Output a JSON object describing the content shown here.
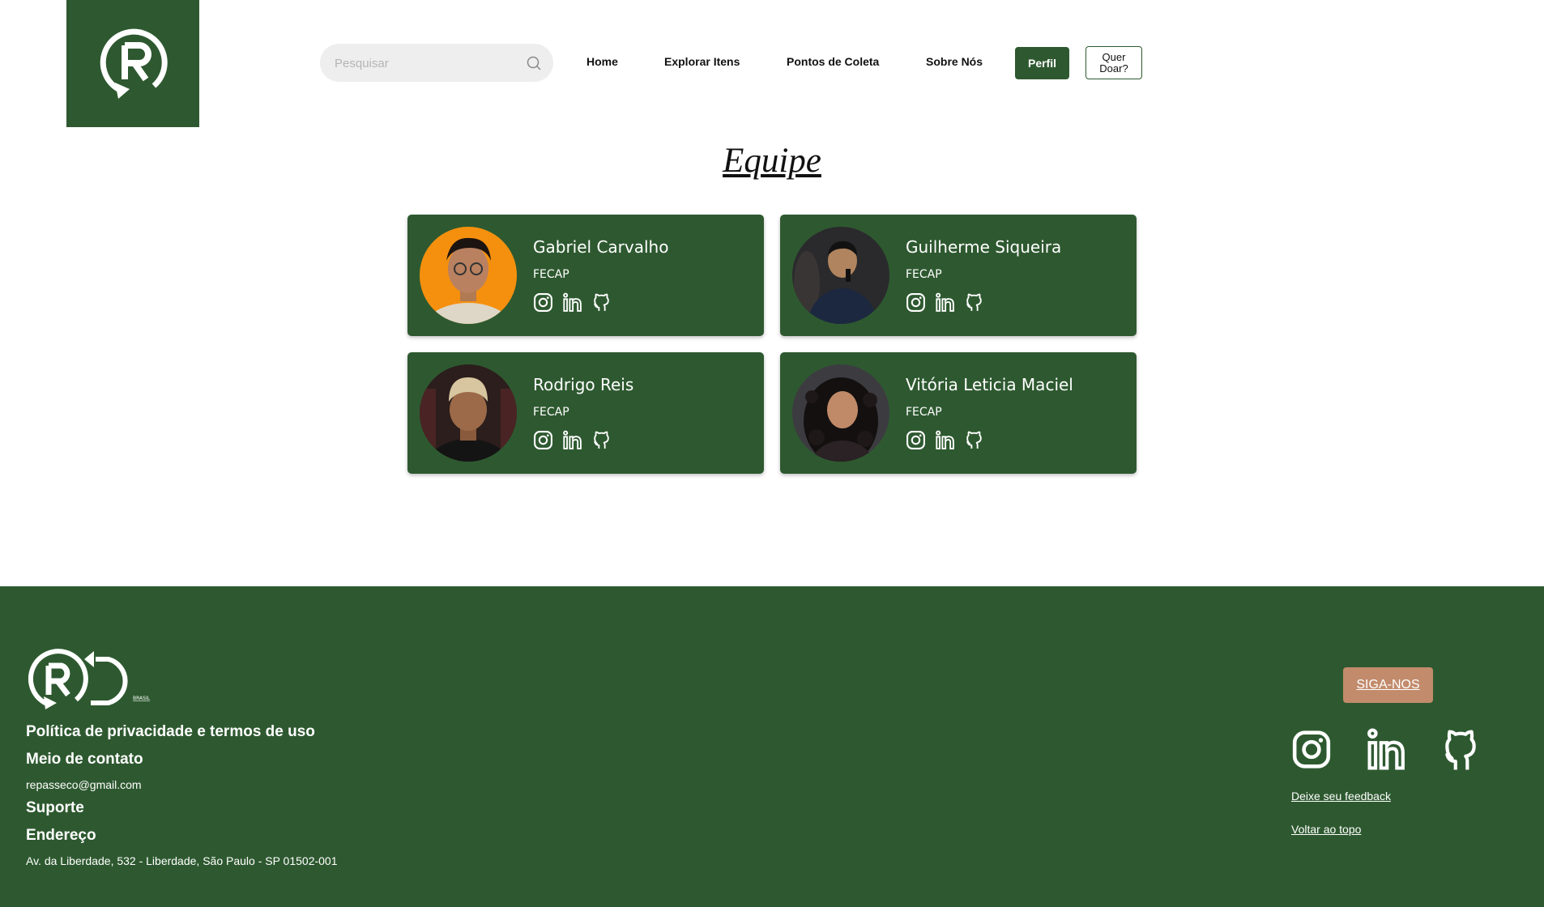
{
  "header": {
    "search_placeholder": "Pesquisar",
    "nav": [
      "Home",
      "Explorar Itens",
      "Pontos de Coleta",
      "Sobre Nós"
    ],
    "perfil": "Perfil",
    "doar": "Quer Doar?"
  },
  "page_title": "Equipe",
  "team": [
    {
      "name": "Gabriel Carvalho",
      "org": "FECAP"
    },
    {
      "name": "Guilherme Siqueira",
      "org": "FECAP"
    },
    {
      "name": "Rodrigo Reis",
      "org": "FECAP"
    },
    {
      "name": "Vitória Leticia Maciel",
      "org": "FECAP"
    }
  ],
  "footer": {
    "logo_subtext": "BRASIL",
    "privacy": "Política de privacidade e termos de uso",
    "contact_heading": "Meio de contato",
    "email": "repasseco@gmail.com",
    "support": "Suporte",
    "address_heading": "Endereço",
    "address": "Av. da Liberdade, 532 - Liberdade, São Paulo - SP 01502-001",
    "follow": "SIGA-NOS",
    "feedback": "Deixe seu feedback",
    "back_to_top": "Voltar ao topo"
  },
  "colors": {
    "brand_green": "#2e5930",
    "accent_copper": "#c28b6c"
  },
  "icons": [
    "search-icon",
    "instagram-icon",
    "linkedin-icon",
    "github-icon",
    "recycle-r-logo"
  ]
}
